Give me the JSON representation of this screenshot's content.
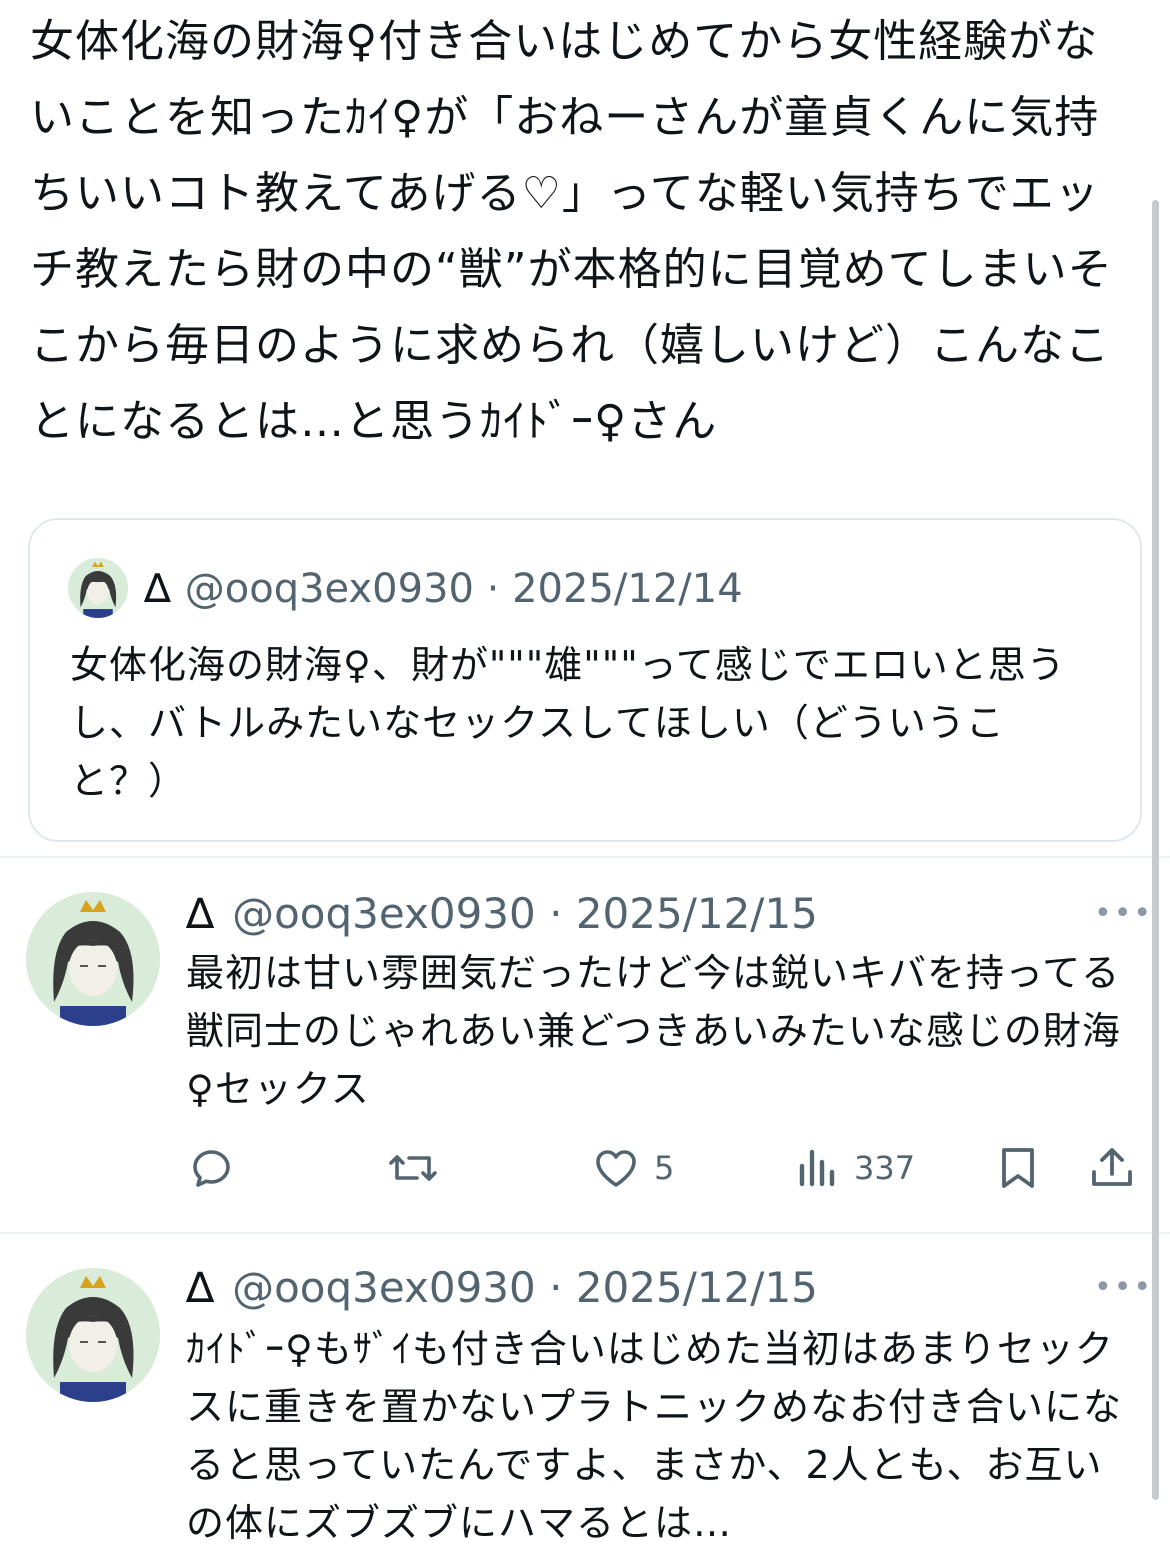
{
  "main_post": {
    "text": "女体化海の財海♀付き合いはじめてから女性経験がないことを知ったｶｲ♀が「おねーさんが童貞くんに気持ちいいコト教えてあげる♡」ってな軽い気持ちでエッチ教えたら財の中の“獣”が本格的に目覚めてしまいそこから毎日のように求められ（嬉しいけど）こんなことになるとは…と思うｶｲﾄﾞｰ♀さん"
  },
  "quote": {
    "name": "∆",
    "handle": "@ooq3ex0930",
    "sep": "·",
    "date": "2025/12/14",
    "text": "女体化海の財海♀、財が\"\"\"雄\"\"\"って感じでエロいと思うし、バトルみたいなセックスしてほしい（どういうこと？）"
  },
  "replies": [
    {
      "name": "∆",
      "handle": "@ooq3ex0930",
      "sep": "·",
      "date": "2025/12/15",
      "more": "•••",
      "text": "最初は甘い雰囲気だったけど今は鋭いキバを持ってる獣同士のじゃれあい兼どつきあいみたいな感じの財海♀セックス",
      "actions": {
        "likes": "5",
        "views": "337"
      }
    },
    {
      "name": "∆",
      "handle": "@ooq3ex0930",
      "sep": "·",
      "date": "2025/12/15",
      "more": "•••",
      "text": "ｶｲﾄﾞｰ♀もｻﾞｲも付き合いはじめた当初はあまりセックスに重きを置かないプラトニックめなお付き合いになると思っていたんですよ、まさか、2人とも、お互いの体にズブズブにハマるとは…"
    }
  ],
  "icons": {
    "reply": "reply-icon",
    "repost": "repost-icon",
    "like": "heart-icon",
    "views": "views-icon",
    "bookmark": "bookmark-icon",
    "share": "share-icon"
  },
  "colors": {
    "text": "#0f1419",
    "secondary": "#536471",
    "border": "#e1e8ed"
  }
}
